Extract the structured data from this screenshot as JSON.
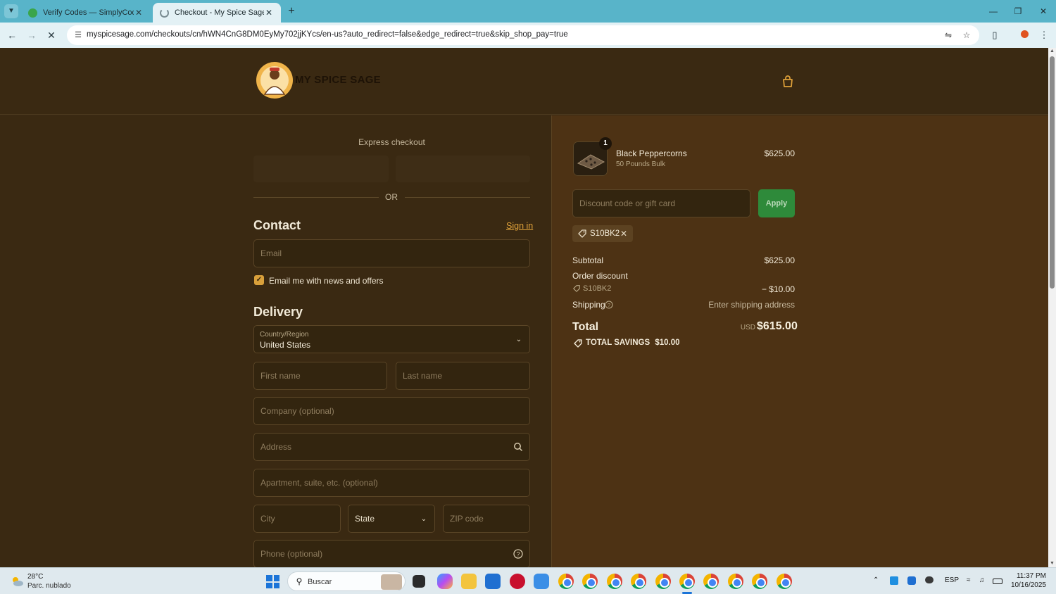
{
  "browser": {
    "tabs": [
      {
        "title": "Verify Codes — SimplyCodes",
        "active": false
      },
      {
        "title": "Checkout - My Spice Sage",
        "active": true
      }
    ],
    "url": "myspicesage.com/checkouts/cn/hWN4CnG8DM0EyMy702jjKYcs/en-us?auto_redirect=false&edge_redirect=true&skip_shop_pay=true"
  },
  "header": {
    "brand": "MY SPICE SAGE"
  },
  "checkout": {
    "express_label": "Express checkout",
    "or_text": "OR",
    "contact_title": "Contact",
    "signin_label": "Sign in",
    "email_placeholder": "Email",
    "newsletter_label": "Email me with news and offers",
    "newsletter_checked": true,
    "delivery_title": "Delivery",
    "country_label": "Country/Region",
    "country_value": "United States",
    "first_name_placeholder": "First name",
    "last_name_placeholder": "Last name",
    "company_placeholder": "Company (optional)",
    "address_placeholder": "Address",
    "apartment_placeholder": "Apartment, suite, etc. (optional)",
    "city_placeholder": "City",
    "state_label": "State",
    "zip_placeholder": "ZIP code",
    "phone_placeholder": "Phone (optional)"
  },
  "summary": {
    "product": {
      "name": "Black Peppercorns",
      "variant": "50 Pounds Bulk",
      "price": "$625.00",
      "quantity": "1"
    },
    "discount_placeholder": "Discount code or gift card",
    "apply_label": "Apply",
    "applied_code": "S10BK2",
    "subtotal_label": "Subtotal",
    "subtotal_value": "$625.00",
    "order_discount_label": "Order discount",
    "order_discount_code": "S10BK2",
    "order_discount_value": "− $10.00",
    "shipping_label": "Shipping",
    "shipping_value": "Enter shipping address",
    "total_label": "Total",
    "currency": "USD",
    "total_value": "$615.00",
    "savings_label": "TOTAL SAVINGS",
    "savings_value": "$10.00"
  },
  "taskbar": {
    "weather_temp": "28°C",
    "weather_desc": "Parc. nublado",
    "search_label": "Buscar",
    "language": "ESP",
    "time": "11:37 PM",
    "date": "10/16/2025"
  },
  "colors": {
    "accent": "#e0a23a",
    "apply_button": "#2e8a3a",
    "page_bg": "#3a2912",
    "summary_bg": "#4d3214"
  }
}
